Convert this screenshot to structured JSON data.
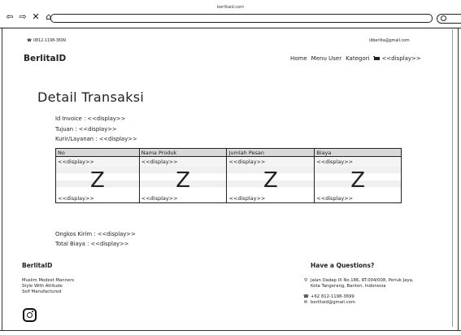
{
  "browser": {
    "url_title": "berlitaid.com",
    "nav_icons": [
      "back-icon",
      "forward-icon",
      "close-icon",
      "home-icon"
    ]
  },
  "topbar": {
    "phone": "0812-1198-3699",
    "email": "idberlita@gmail.com"
  },
  "header": {
    "brand": "BerlitaID",
    "nav": [
      "Home",
      "Menu User",
      "Kategori"
    ],
    "cart_label": "<<display>>"
  },
  "main": {
    "title": "Detail Transaksi",
    "invoice": "Id Invoice : <<display>>",
    "tujuan": "Tujuan : <<display>>",
    "kurir": "Kurir/Layanan : <<display>>",
    "table": {
      "headers": [
        "No",
        "Nama Produk",
        "Jumlah Pesan",
        "Biaya"
      ],
      "row_top": [
        "<<display>>",
        "<<display>>",
        "<<display>>",
        "<<display>>"
      ],
      "row_mid": [
        "Z",
        "Z",
        "Z",
        "Z"
      ],
      "row_bottom": [
        "<<display>>",
        "<<display>>",
        "<<display>>",
        "<<display>>"
      ]
    },
    "ongkos": "Ongkos Kirim :  <<display>>",
    "total": "Total Biaya :  <<display>>"
  },
  "footer": {
    "brand": "BerlitaID",
    "taglines": [
      "Muslim Modest Manners",
      "Style With Attitude",
      "Self Manufactured"
    ],
    "question_title": "Have a Questions?",
    "address_line1": "Jalan Dadap IX No.186, RT.004/008, Periuk Jaya,",
    "address_line2": "Kota Tangerang, Banten, Indonesia",
    "phone": "+62 812-1198-3699",
    "email": "berlitaid@gmail.com"
  }
}
